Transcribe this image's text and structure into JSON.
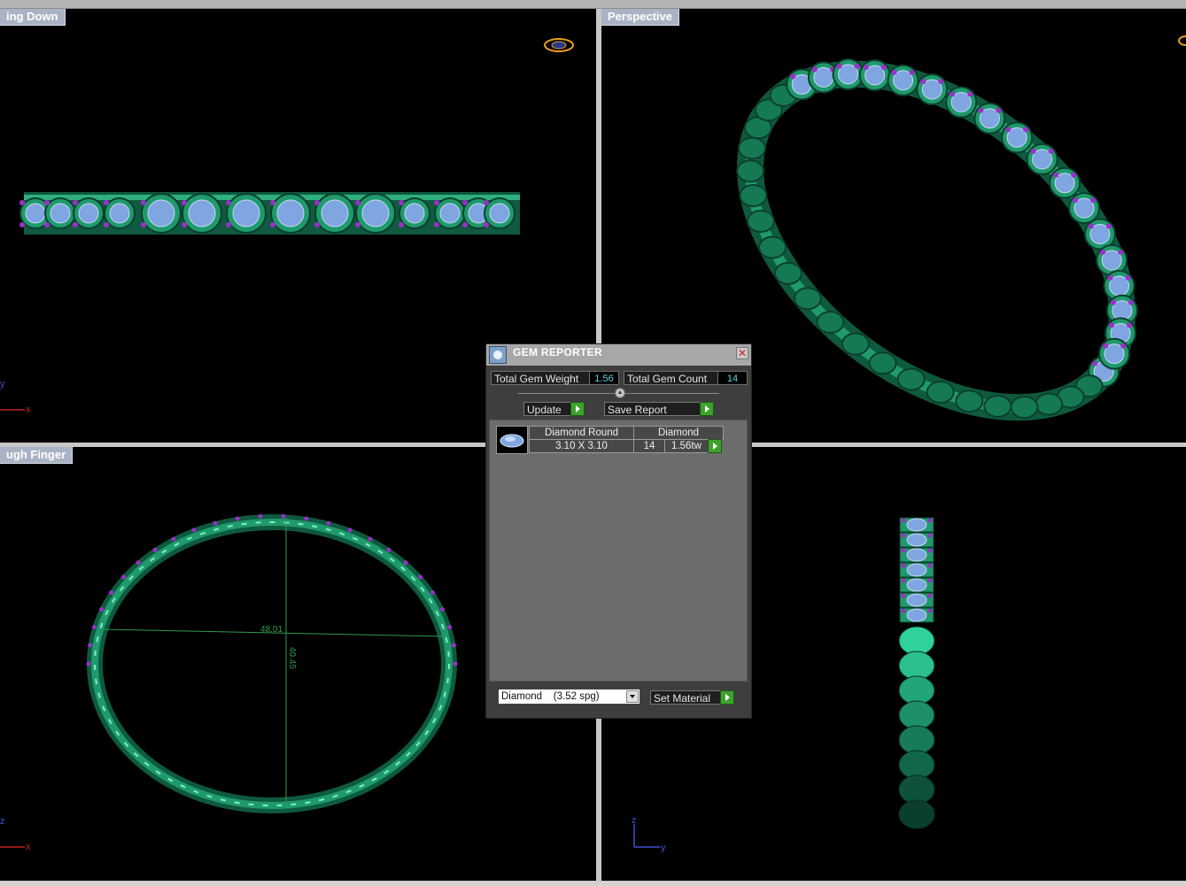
{
  "viewports": {
    "top_left": {
      "label": "ing Down",
      "axis_x": "x",
      "axis_y": "y"
    },
    "top_right": {
      "label": "Perspective"
    },
    "bottom_left": {
      "label": "ugh Finger",
      "axis_x": "x",
      "axis_y": "z",
      "dim_horizontal": "48.01",
      "dim_vertical": "40.45"
    },
    "bottom_right": {
      "label": "",
      "axis_h": "y",
      "axis_v": "z"
    }
  },
  "gem_reporter": {
    "title": "GEM REPORTER",
    "total_weight_label": "Total Gem Weight",
    "total_weight_value": "1.56",
    "total_count_label": "Total Gem Count",
    "total_count_value": "14",
    "update_button": "Update",
    "save_report_button": "Save Report",
    "gems": [
      {
        "shape": "Diamond Round",
        "material": "Diamond",
        "size": "3.10 X 3.10",
        "count": "14",
        "weight": "1.56tw"
      }
    ],
    "material_select": "Diamond    (3.52 spg)",
    "set_material_button": "Set Material"
  },
  "colors": {
    "metal": "#1f9a6c",
    "gem": "#7fa6e0",
    "prong": "#9b2fc9",
    "viewport_bg": "#000000",
    "label_bg": "#a9b3c4"
  }
}
